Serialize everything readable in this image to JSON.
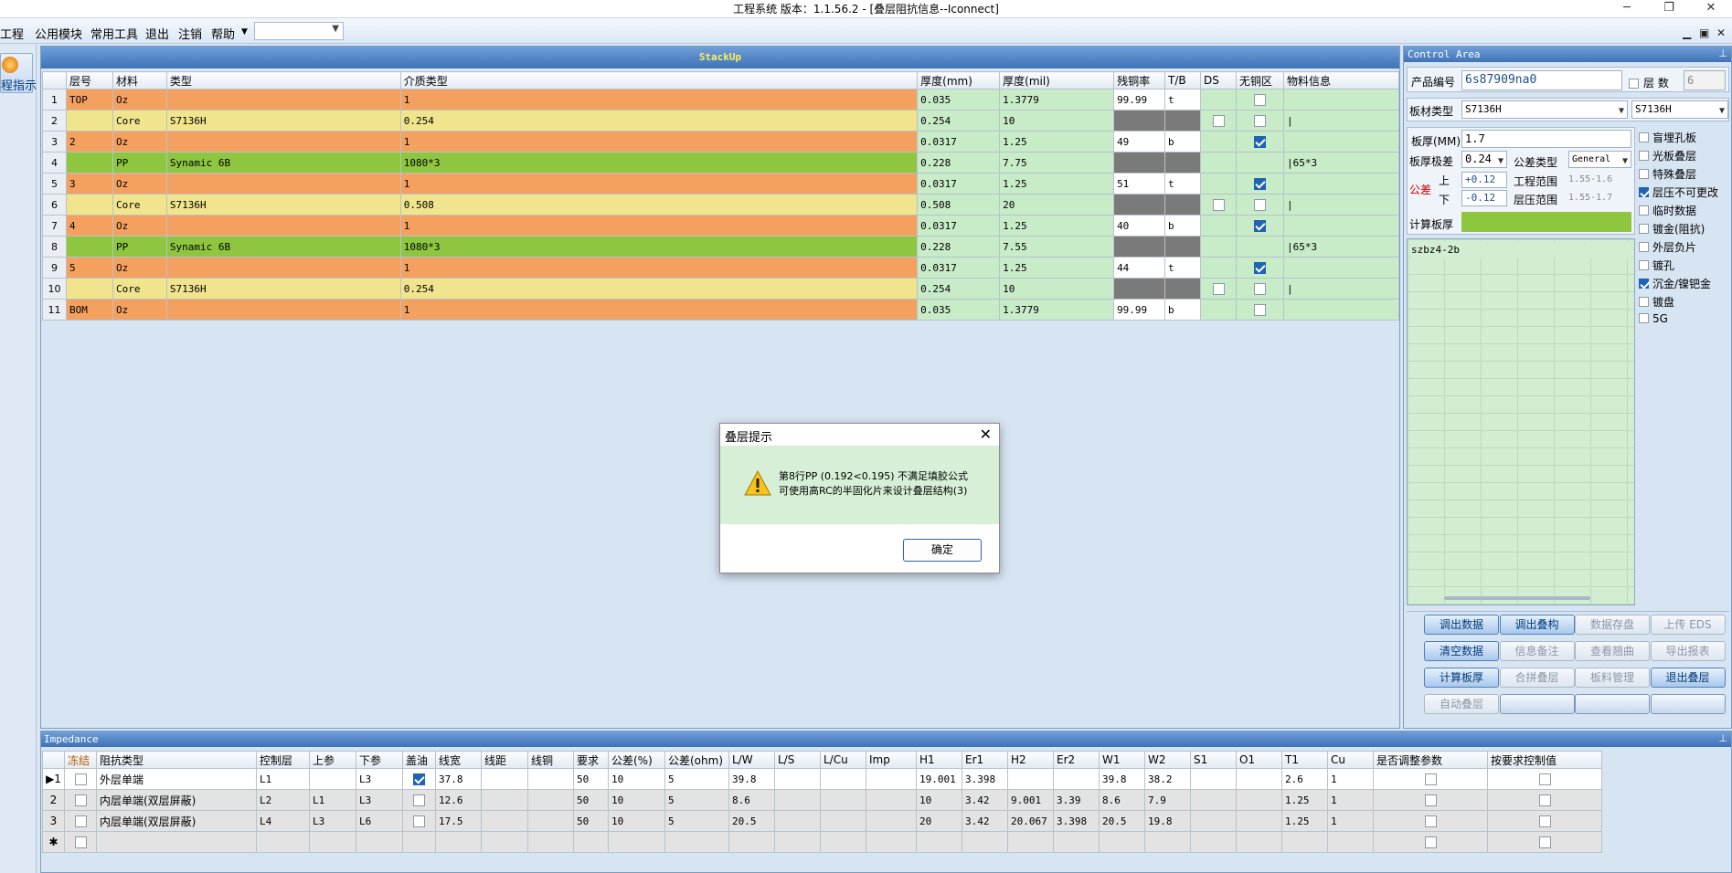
{
  "window": {
    "title": "工程系统   版本：1.1.56.2 - [叠层阻抗信息--Iconnect]"
  },
  "menu": {
    "items": [
      "工程",
      "公用模块",
      "常用工具",
      "退出",
      "注销",
      "帮助"
    ],
    "combo_value": ""
  },
  "left_button": {
    "label": "程指示"
  },
  "stackup": {
    "title": "StackUp",
    "columns": [
      "层号",
      "材料",
      "类型",
      "介质类型",
      "厚度(mm)",
      "厚度(mil)",
      "残铜率",
      "T/B",
      "DS",
      "无铜区",
      "物料信息"
    ],
    "rows": [
      {
        "n": "1",
        "layer": "TOP",
        "mat": "Oz",
        "type": "",
        "medium": "1",
        "mm": "0.035",
        "mil": "1.3779",
        "cu": "99.99",
        "tb": "t",
        "noCu": false,
        "info": "",
        "kind": "oz"
      },
      {
        "n": "2",
        "layer": "",
        "mat": "Core",
        "type": "S7136H",
        "medium": "0.254",
        "mm": "0.254",
        "mil": "10",
        "cu": "",
        "tb": "",
        "noCu": false,
        "info": "|",
        "kind": "core"
      },
      {
        "n": "3",
        "layer": "2",
        "mat": "Oz",
        "type": "",
        "medium": "1",
        "mm": "0.0317",
        "mil": "1.25",
        "cu": "49",
        "tb": "b",
        "noCu": true,
        "info": "",
        "kind": "oz"
      },
      {
        "n": "4",
        "layer": "",
        "mat": "PP",
        "type": "Synamic 6B",
        "medium": "1080*3",
        "mm": "0.228",
        "mil": "7.75",
        "cu": "",
        "tb": "",
        "noCu": false,
        "info": "|65*3",
        "kind": "pp"
      },
      {
        "n": "5",
        "layer": "3",
        "mat": "Oz",
        "type": "",
        "medium": "1",
        "mm": "0.0317",
        "mil": "1.25",
        "cu": "51",
        "tb": "t",
        "noCu": true,
        "info": "",
        "kind": "oz"
      },
      {
        "n": "6",
        "layer": "",
        "mat": "Core",
        "type": "S7136H",
        "medium": "0.508",
        "mm": "0.508",
        "mil": "20",
        "cu": "",
        "tb": "",
        "noCu": false,
        "info": "|",
        "kind": "core"
      },
      {
        "n": "7",
        "layer": "4",
        "mat": "Oz",
        "type": "",
        "medium": "1",
        "mm": "0.0317",
        "mil": "1.25",
        "cu": "40",
        "tb": "b",
        "noCu": true,
        "info": "",
        "kind": "oz"
      },
      {
        "n": "8",
        "layer": "",
        "mat": "PP",
        "type": "Synamic 6B",
        "medium": "1080*3",
        "mm": "0.228",
        "mil": "7.55",
        "cu": "",
        "tb": "",
        "noCu": false,
        "info": "|65*3",
        "kind": "pp"
      },
      {
        "n": "9",
        "layer": "5",
        "mat": "Oz",
        "type": "",
        "medium": "1",
        "mm": "0.0317",
        "mil": "1.25",
        "cu": "44",
        "tb": "t",
        "noCu": true,
        "info": "",
        "kind": "oz"
      },
      {
        "n": "10",
        "layer": "",
        "mat": "Core",
        "type": "S7136H",
        "medium": "0.254",
        "mm": "0.254",
        "mil": "10",
        "cu": "",
        "tb": "",
        "noCu": false,
        "info": "|",
        "kind": "core"
      },
      {
        "n": "11",
        "layer": "BOM",
        "mat": "Oz",
        "type": "",
        "medium": "1",
        "mm": "0.035",
        "mil": "1.3779",
        "cu": "99.99",
        "tb": "b",
        "noCu": false,
        "info": "",
        "kind": "oz"
      }
    ]
  },
  "impedance": {
    "title": "Impedance",
    "columns": [
      "冻结",
      "阻抗类型",
      "控制层",
      "上参",
      "下参",
      "盖油",
      "线宽",
      "线距",
      "线铜",
      "要求",
      "公差(%)",
      "公差(ohm)",
      "L/W",
      "L/S",
      "L/Cu",
      "Imp",
      "H1",
      "Er1",
      "H2",
      "Er2",
      "W1",
      "W2",
      "S1",
      "O1",
      "T1",
      "Cu",
      "是否调整参数",
      "按要求控制值"
    ],
    "rows": [
      {
        "n": "▶1",
        "type": "外层单端",
        "ctrl": "L1",
        "up": "",
        "down": "L3",
        "oil": true,
        "lw": "37.8",
        "ls": "",
        "lcu": "",
        "req": "50",
        "tolp": "10",
        "tolo": "5",
        "LW": "39.8",
        "LS": "",
        "LCu": "",
        "imp": "",
        "H1": "19.001",
        "Er1": "3.398",
        "H2": "",
        "Er2": "",
        "W1": "39.8",
        "W2": "38.2",
        "S1": "",
        "O1": "",
        "T1": "2.6",
        "Cu": "1"
      },
      {
        "n": "2",
        "type": "内层单端(双层屏蔽)",
        "ctrl": "L2",
        "up": "L1",
        "down": "L3",
        "oil": false,
        "lw": "12.6",
        "ls": "",
        "lcu": "",
        "req": "50",
        "tolp": "10",
        "tolo": "5",
        "LW": "8.6",
        "LS": "",
        "LCu": "",
        "imp": "",
        "H1": "10",
        "Er1": "3.42",
        "H2": "9.001",
        "Er2": "3.39",
        "W1": "8.6",
        "W2": "7.9",
        "S1": "",
        "O1": "",
        "T1": "1.25",
        "Cu": "1"
      },
      {
        "n": "3",
        "type": "内层单端(双层屏蔽)",
        "ctrl": "L4",
        "up": "L3",
        "down": "L6",
        "oil": false,
        "lw": "17.5",
        "ls": "",
        "lcu": "",
        "req": "50",
        "tolp": "10",
        "tolo": "5",
        "LW": "20.5",
        "LS": "",
        "LCu": "",
        "imp": "",
        "H1": "20",
        "Er1": "3.42",
        "H2": "20.067",
        "Er2": "3.398",
        "W1": "20.5",
        "W2": "19.8",
        "S1": "",
        "O1": "",
        "T1": "1.25",
        "Cu": "1"
      }
    ],
    "new_row_marker": "✱"
  },
  "control": {
    "title": "Control Area",
    "product_label": "产品编号",
    "product_value": "6s87909na0",
    "layer_label": "层 数",
    "layer_value": "6",
    "board_type_label": "板材类型",
    "board_type_1": "S7136H",
    "board_type_2": "S7136H",
    "thick_label": "板厚(MM)",
    "thick_value": "1.7",
    "pole_label": "板厚极差",
    "pole_value": "0.24",
    "tol_type_label": "公差类型",
    "tol_type_value": "General",
    "tol_label": "公差",
    "up_label": "上",
    "down_label": "下",
    "up_value": "+0.12",
    "down_value": "-0.12",
    "eng_range_label": "工程范围",
    "eng_range_value": "1.55-1.6",
    "press_range_label": "层压范围",
    "press_range_value": "1.55-1.7",
    "calc_label": "计算板厚",
    "calc_value": "",
    "list_item": "szbz4-2b",
    "options": [
      {
        "label": "盲埋孔板",
        "checked": false
      },
      {
        "label": "光板叠层",
        "checked": false
      },
      {
        "label": "特殊叠层",
        "checked": false
      },
      {
        "label": "层压不可更改",
        "checked": true
      },
      {
        "label": "临时数据",
        "checked": false
      },
      {
        "label": "镀金(阻抗)",
        "checked": false
      },
      {
        "label": "外层负片",
        "checked": false
      },
      {
        "label": "镀孔",
        "checked": false
      },
      {
        "label": "沉金/镍钯金",
        "checked": true
      },
      {
        "label": "镀盘",
        "checked": false
      },
      {
        "label": "5G",
        "checked": false
      }
    ],
    "buttons": [
      "调出数据",
      "调出叠构",
      "数据存盘",
      "上传 EDS",
      "清空数据",
      "信息备注",
      "查看翘曲",
      "导出报表",
      "计算板厚",
      "合拼叠层",
      "板料管理",
      "退出叠层",
      "自动叠层",
      "",
      "",
      ""
    ]
  },
  "dialog": {
    "title": "叠层提示",
    "line1": "第8行PP (0.192<0.195) 不满足填胶公式",
    "line2": "可使用高RC的半固化片来设计叠层结构(3)",
    "ok": "确定"
  }
}
